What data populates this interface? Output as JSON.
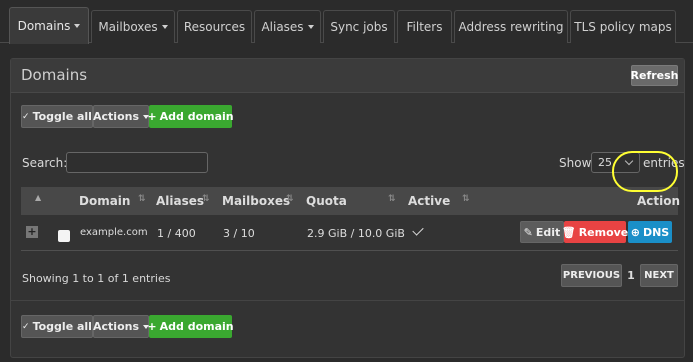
{
  "tabs": [
    {
      "label": "Domains",
      "dropdown": true,
      "active": true
    },
    {
      "label": "Mailboxes",
      "dropdown": true
    },
    {
      "label": "Resources",
      "dropdown": false
    },
    {
      "label": "Aliases",
      "dropdown": true
    },
    {
      "label": "Sync jobs",
      "dropdown": false
    },
    {
      "label": "Filters",
      "dropdown": false
    },
    {
      "label": "Address rewriting",
      "dropdown": false
    },
    {
      "label": "TLS policy maps",
      "dropdown": false
    }
  ],
  "panel": {
    "title": "Domains",
    "refresh_label": "Refresh"
  },
  "toolbar": {
    "toggle_all_label": "Toggle all",
    "actions_label": "Actions",
    "add_domain_label": "Add domain"
  },
  "search": {
    "label": "Search:",
    "value": ""
  },
  "page_length": {
    "show_label": "Show",
    "value": "25",
    "entries_label": "entries"
  },
  "table": {
    "headers": {
      "domain": "Domain",
      "aliases": "Aliases",
      "mailboxes": "Mailboxes",
      "quota": "Quota",
      "active": "Active",
      "action": "Action"
    },
    "rows": [
      {
        "domain": "example.com",
        "aliases": "1 / 400",
        "mailboxes": "3 / 10",
        "quota": "2.9 GiB / 10.0 GiB",
        "active": true,
        "edit_label": "Edit",
        "remove_label": "Remove",
        "dns_label": "DNS"
      }
    ]
  },
  "footer": {
    "showing_text": "Showing 1 to 1 of 1 entries",
    "previous_label": "PREVIOUS",
    "current_page": "1",
    "next_label": "NEXT"
  },
  "colors": {
    "add_button": "#3aa830",
    "remove_button": "#e84343",
    "dns_button": "#1a8fc8",
    "highlight_annotation": "#ffff33"
  }
}
